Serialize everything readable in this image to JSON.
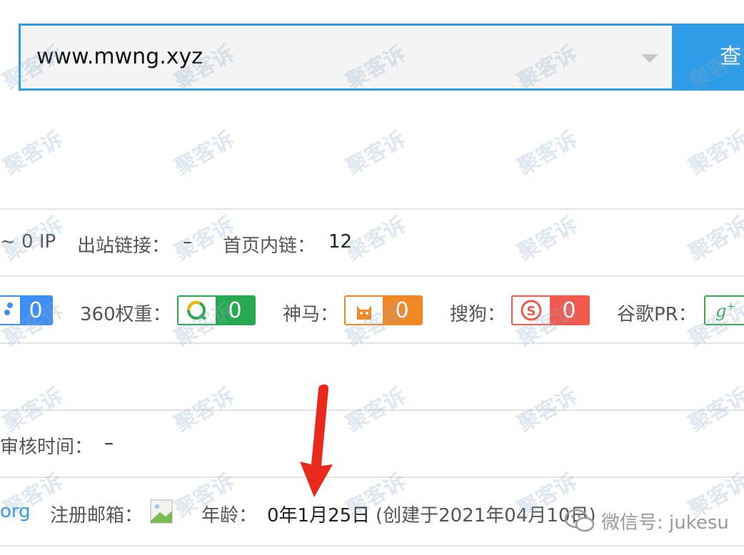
{
  "search": {
    "value": "www.mwng.xyz",
    "button_label": "查"
  },
  "row_links": {
    "ip_prefix": "~ 0 IP",
    "outbound_label": "出站链接：",
    "outbound_value": "–",
    "inner_label": "首页内链：",
    "inner_value": "12"
  },
  "row_weights": {
    "baidu_value": "0",
    "so360_label": "360权重：",
    "so360_value": "0",
    "shenma_label": "神马：",
    "shenma_value": "0",
    "sogou_label": "搜狗：",
    "sogou_value": "0",
    "google_label": "谷歌PR："
  },
  "row_review": {
    "label": "审核时间：",
    "value": "–"
  },
  "row_whois": {
    "org_fragment": "org",
    "email_label": "注册邮箱：",
    "age_label": "年龄：",
    "age_value": "0年1月25日",
    "created_text": "(创建于2021年04月10日)"
  },
  "watermark": {
    "text": "聚客诉",
    "wechat_text": "微信号: jukesu"
  },
  "colors": {
    "accent_blue": "#2e9ce6",
    "badge_baidu": "#3d8ff0",
    "badge_360": "#29a852",
    "badge_shenma": "#f08826",
    "badge_sogou": "#f05a4f",
    "badge_google": "#3aa856",
    "arrow_red": "#e8291c"
  }
}
